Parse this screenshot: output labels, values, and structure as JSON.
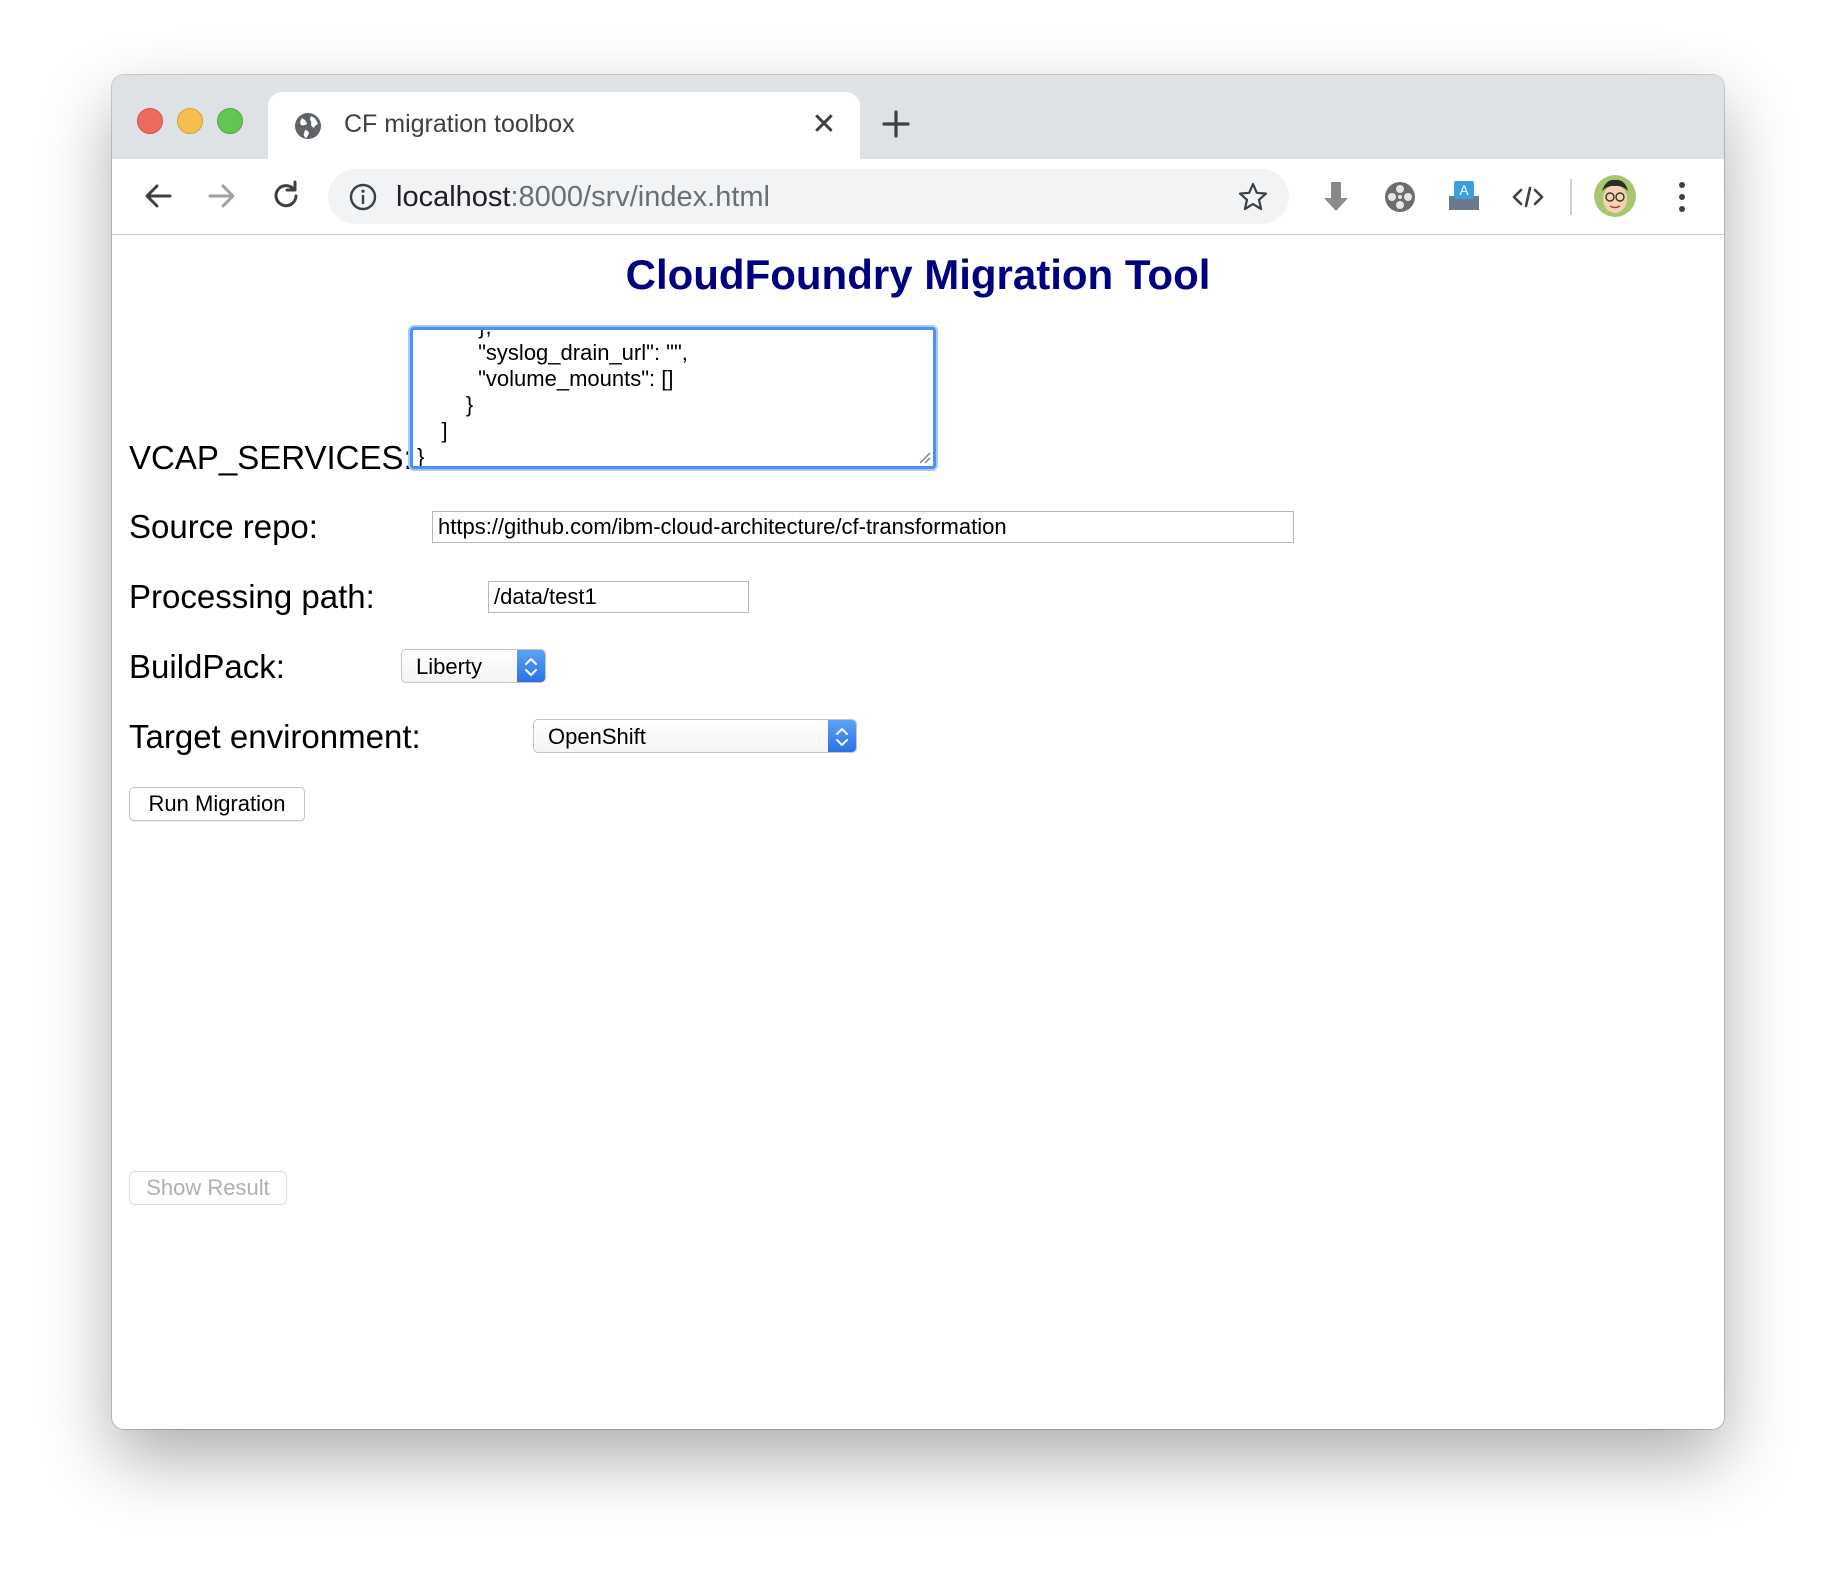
{
  "browser": {
    "tab_title": "CF migration toolbox",
    "url_host": "localhost",
    "url_rest": ":8000/srv/index.html"
  },
  "page": {
    "title": "CloudFoundry Migration Tool",
    "vcap_label": "VCAP_SERVICES:",
    "vcap_value": "          },\n          \"syslog_drain_url\": \"\",\n          \"volume_mounts\": []\n        }\n    ]\n}",
    "source_repo_label": "Source repo:",
    "source_repo_value": "https://github.com/ibm-cloud-architecture/cf-transformation",
    "processing_path_label": "Processing path:",
    "processing_path_value": "/data/test1",
    "buildpack_label": "BuildPack:",
    "buildpack_value": "Liberty",
    "target_env_label": "Target environment:",
    "target_env_value": "OpenShift",
    "run_button": "Run Migration",
    "show_result_button": "Show Result"
  },
  "colors": {
    "title": "#000080",
    "focus_ring": "#4c8ff5"
  }
}
